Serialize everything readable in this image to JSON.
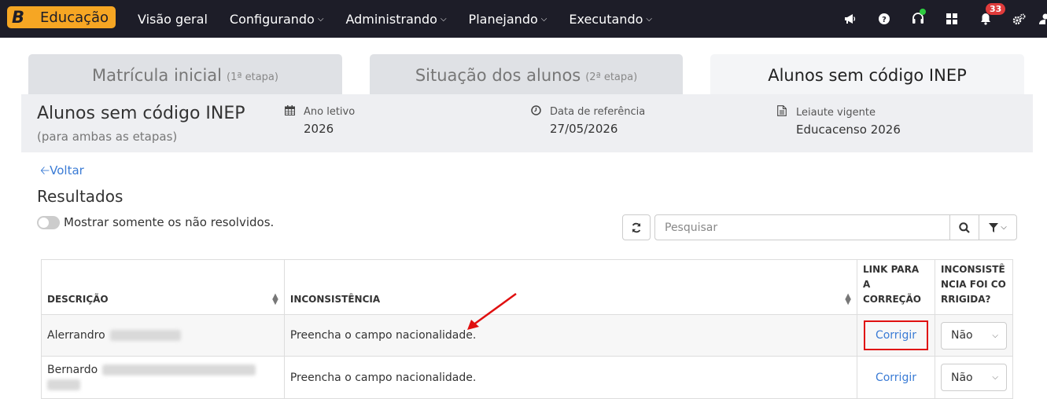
{
  "brand": {
    "letter": "B",
    "name": "Educação"
  },
  "nav": [
    {
      "label": "Visão geral",
      "dropdown": false
    },
    {
      "label": "Configurando",
      "dropdown": true
    },
    {
      "label": "Administrando",
      "dropdown": true
    },
    {
      "label": "Planejando",
      "dropdown": true
    },
    {
      "label": "Executando",
      "dropdown": true
    }
  ],
  "header_icons": {
    "notifications_count": "33"
  },
  "tabs": [
    {
      "label": "Matrícula inicial",
      "note": "(1ª etapa)"
    },
    {
      "label": "Situação dos alunos",
      "note": "(2ª etapa)"
    },
    {
      "label": "Alunos sem código INEP",
      "note": ""
    }
  ],
  "summary": {
    "title": "Alunos sem código INEP",
    "subtitle": "(para ambas as etapas)",
    "meta": [
      {
        "label": "Ano letivo",
        "value": "2026",
        "icon": "calendar-icon"
      },
      {
        "label": "Data de referência",
        "value": "27/05/2026",
        "icon": "clock-icon"
      },
      {
        "label": "Leiaute vigente",
        "value": "Educacenso 2026",
        "icon": "file-icon"
      }
    ]
  },
  "back_label": "Voltar",
  "results_title": "Resultados",
  "toggle_label": "Mostrar somente os não resolvidos.",
  "search": {
    "placeholder": "Pesquisar"
  },
  "table": {
    "headers": {
      "descricao": "DESCRIÇÃO",
      "inconsistencia": "INCONSISTÊNCIA",
      "link": "LINK PARA A CORREÇÃO",
      "corrigida": "INCONSISTÊNCIA FOI CORRIGIDA?"
    },
    "rows": [
      {
        "name": "Alerrandro",
        "issue": "Preencha o campo nacionalidade.",
        "link": "Corrigir",
        "fixed": "Não"
      },
      {
        "name": "Bernardo",
        "issue": "Preencha o campo nacionalidade.",
        "link": "Corrigir",
        "fixed": "Não"
      }
    ]
  }
}
